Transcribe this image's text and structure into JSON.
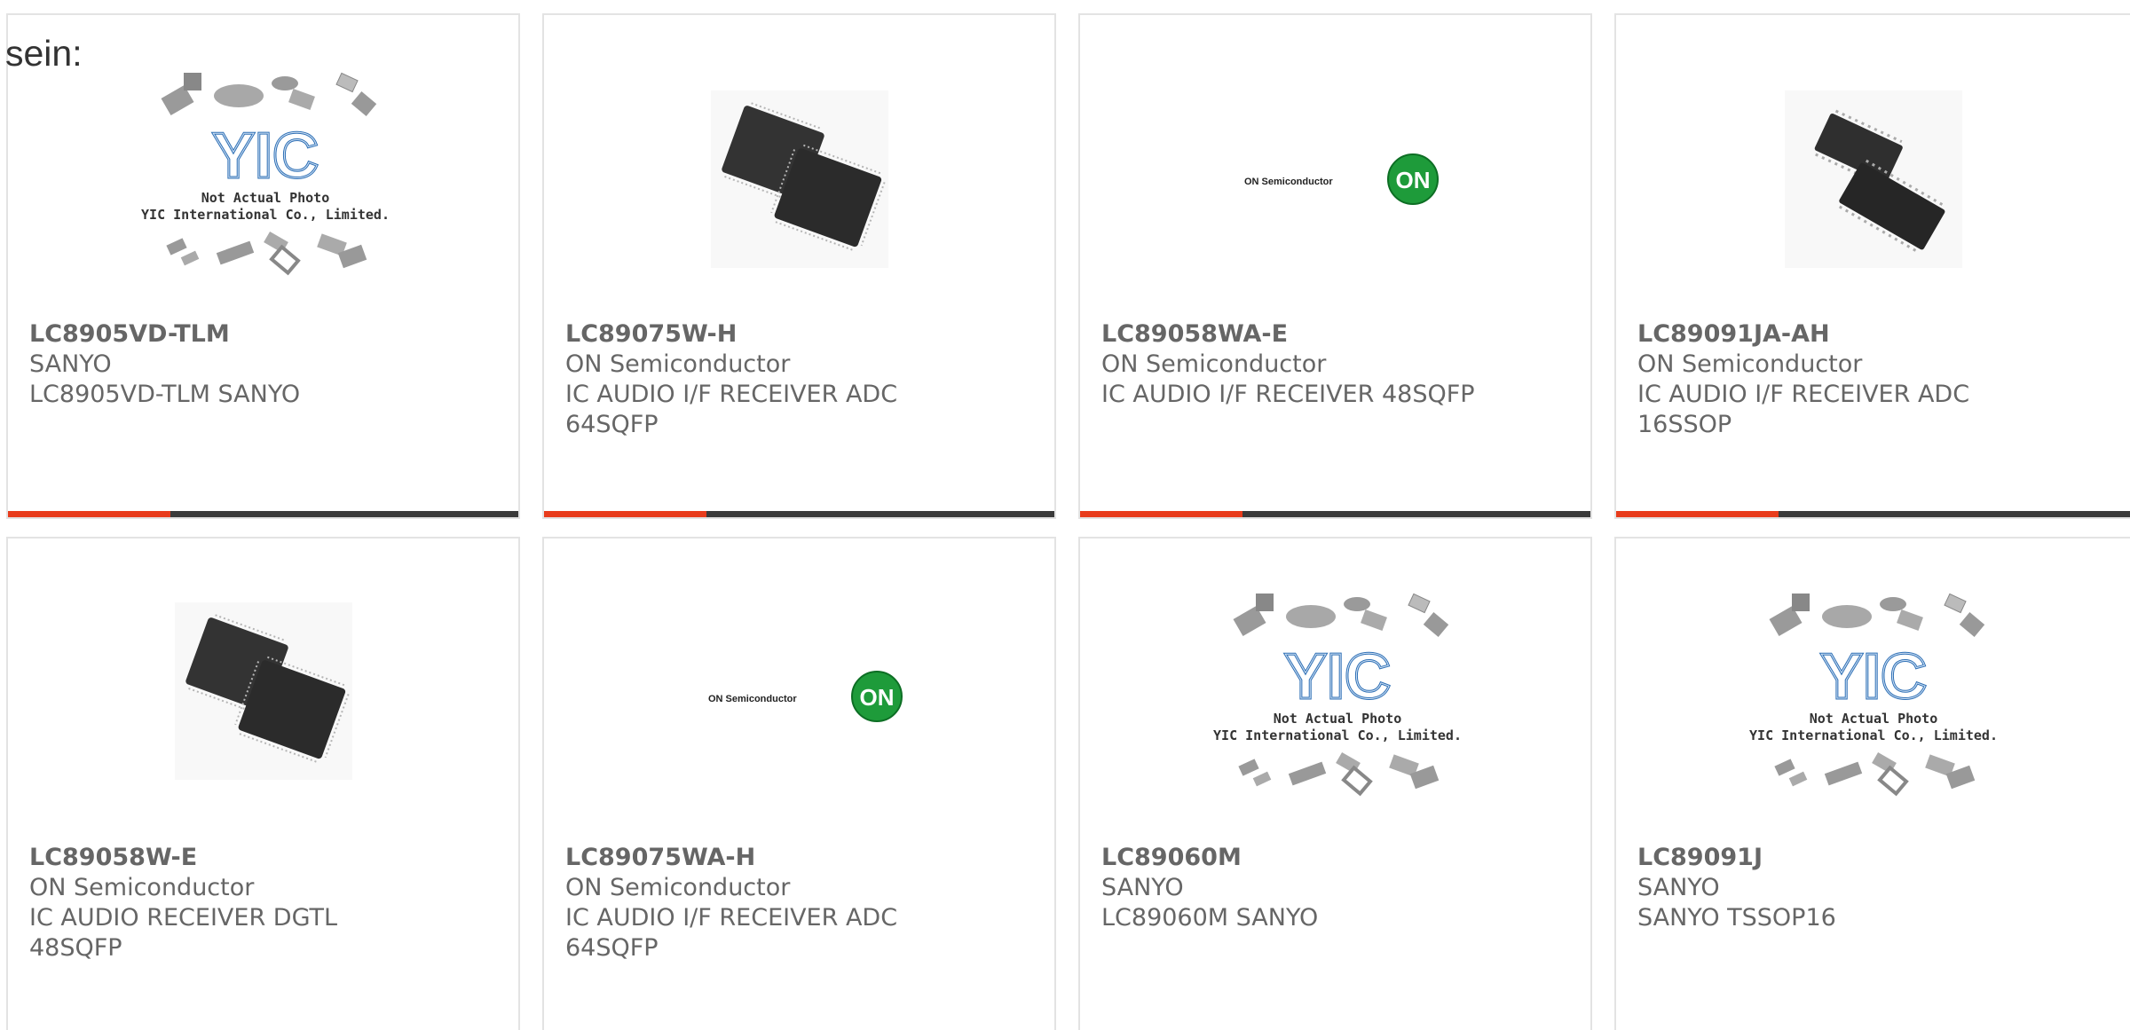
{
  "heading": "sein:",
  "colors": {
    "accent": "#e83c1c",
    "bar": "#3a3a3a",
    "text": "#666666",
    "border": "#e3e3e3",
    "on_logo_green": "#1e9b3a"
  },
  "placeholder_image": {
    "brand": "YIC",
    "line1": "Not Actual Photo",
    "line2": "YIC International Co., Limited."
  },
  "on_logo": {
    "wordmark": "ON Semiconductor",
    "badge": "ON"
  },
  "products": [
    {
      "part": "LC8905VD-TLM",
      "maker": "SANYO",
      "desc_lines": [
        "LC8905VD-TLM SANYO"
      ],
      "image": "yic-placeholder-icon"
    },
    {
      "part": "LC89075W-H",
      "maker": "ON Semiconductor",
      "desc_lines": [
        "IC AUDIO I/F RECEIVER ADC",
        "64SQFP"
      ],
      "image": "qfp-chip-photo"
    },
    {
      "part": "LC89058WA-E",
      "maker": "ON Semiconductor",
      "desc_lines": [
        "IC AUDIO I/F RECEIVER 48SQFP"
      ],
      "image": "on-semiconductor-logo"
    },
    {
      "part": "LC89091JA-AH",
      "maker": "ON Semiconductor",
      "desc_lines": [
        "IC AUDIO I/F RECEIVER ADC",
        "16SSOP"
      ],
      "image": "ssop-chip-photo"
    },
    {
      "part": "LC89058W-E",
      "maker": "ON Semiconductor",
      "desc_lines": [
        "IC AUDIO RECEIVER DGTL",
        "48SQFP"
      ],
      "image": "qfp-chip-photo"
    },
    {
      "part": "LC89075WA-H",
      "maker": "ON Semiconductor",
      "desc_lines": [
        "IC AUDIO I/F RECEIVER ADC",
        "64SQFP"
      ],
      "image": "on-semiconductor-logo"
    },
    {
      "part": "LC89060M",
      "maker": "SANYO",
      "desc_lines": [
        "LC89060M SANYO"
      ],
      "image": "yic-placeholder-icon"
    },
    {
      "part": "LC89091J",
      "maker": "SANYO",
      "desc_lines": [
        "SANYO TSSOP16"
      ],
      "image": "yic-placeholder-icon"
    }
  ]
}
